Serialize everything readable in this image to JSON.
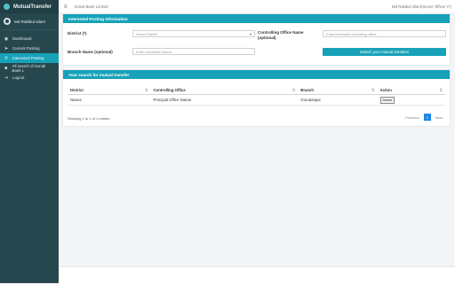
{
  "app": {
    "name": "MutualTransfer"
  },
  "user": {
    "name": "Md Rakibul Islam"
  },
  "sidebar": {
    "items": [
      {
        "label": "Dashboard",
        "icon": "dashboard-icon"
      },
      {
        "label": "Current Posting",
        "icon": "send-icon"
      },
      {
        "label": "Interested Posting",
        "icon": "location-icon"
      },
      {
        "label": "All search of Sonali Bank L",
        "icon": "users-icon"
      },
      {
        "label": "Logout",
        "icon": "logout-icon"
      }
    ],
    "active_index": 2
  },
  "topbar": {
    "company": "Sonali Bank Limited",
    "user_role": "Md Rakibul Islam(Senior Officer IT)"
  },
  "form": {
    "title": "Interested Posting Information",
    "district_label": "District (*)",
    "district_value": "Select District",
    "controlling_office_label": "Controlling Office Name",
    "controlling_office_optional": "(optional)",
    "controlling_office_placeholder": "Enter interested controlling office",
    "branch_label": "Branch Name (optional)",
    "branch_placeholder": "Enter interested branch",
    "search_button": "Search your mutual transfers"
  },
  "results": {
    "title": "Your search for mutual transfer",
    "columns": [
      "District",
      "Controlling Office",
      "Branch",
      "Action"
    ],
    "rows": [
      {
        "district": "Natore",
        "office": "Principal Office Natore",
        "branch": "Gurudaspur",
        "action": "Delete"
      }
    ],
    "showing": "Showing 1 to 1 of 1 entries",
    "pagination": {
      "previous": "Previous",
      "page": "1",
      "next": "Next"
    }
  },
  "colors": {
    "sidebar": "#27474e",
    "accent": "#17a2b8",
    "page_active": "#1e88e5"
  }
}
